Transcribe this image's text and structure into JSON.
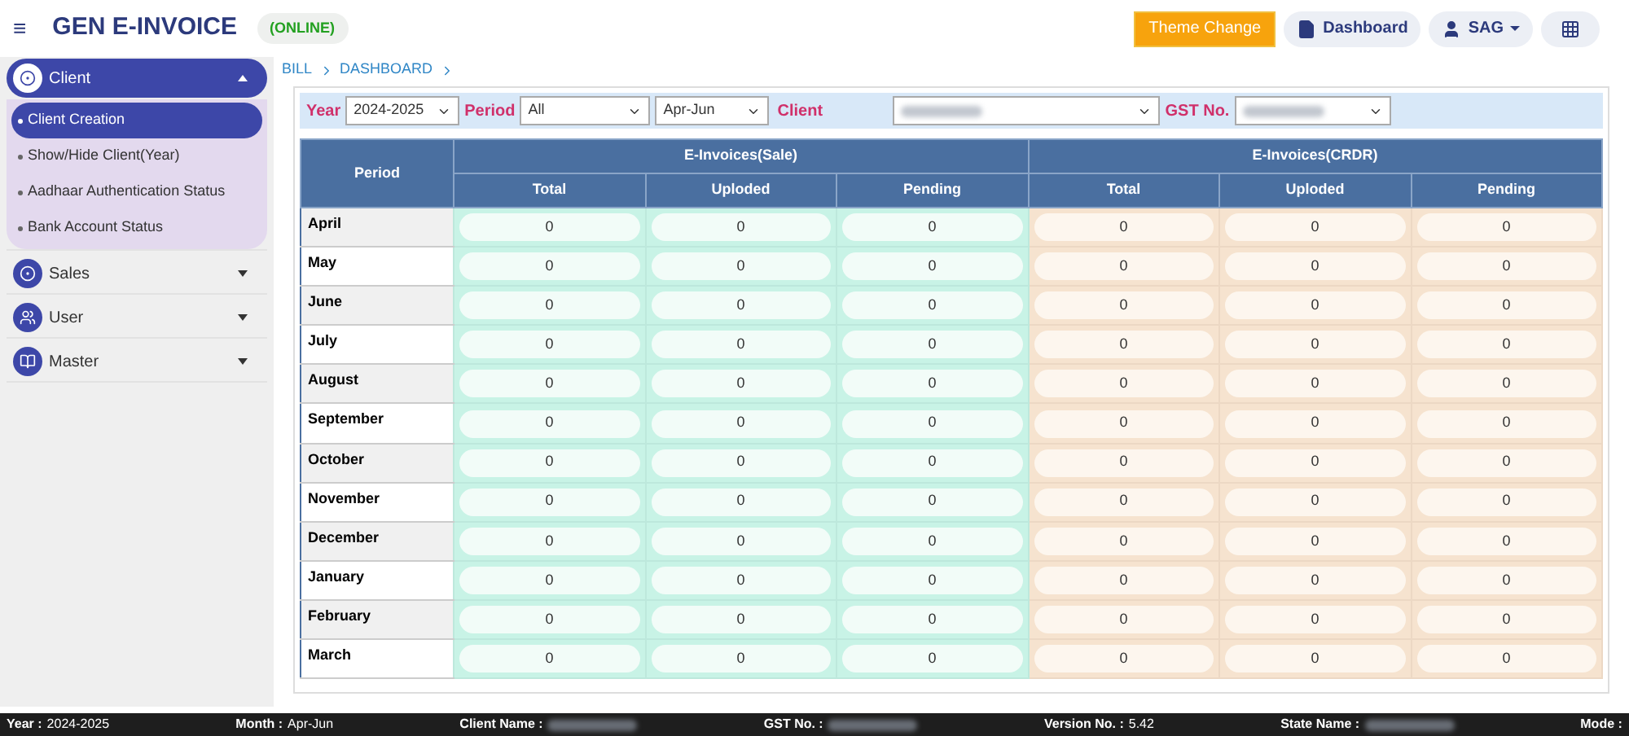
{
  "header": {
    "menu_glyph": "≡",
    "title": "GEN E-INVOICE",
    "status": "(ONLINE)",
    "buttons": [
      {
        "kind": "theme",
        "label": "Theme Change"
      },
      {
        "kind": "page",
        "label": "Dashboard"
      },
      {
        "kind": "user",
        "label": "SAG"
      },
      {
        "kind": "apps"
      }
    ]
  },
  "sidebar": {
    "items": [
      {
        "label": "Client",
        "expanded": true,
        "children": [
          {
            "label": "Client Creation",
            "selected": true
          },
          {
            "label": "Show/Hide Client(Year)",
            "selected": false
          },
          {
            "label": "Aadhaar Authentication Status",
            "selected": false
          },
          {
            "label": "Bank Account Status",
            "selected": false
          }
        ]
      },
      {
        "label": "Sales",
        "expanded": false
      },
      {
        "label": "User",
        "expanded": false
      },
      {
        "label": "Master",
        "expanded": false
      }
    ]
  },
  "breadcrumb": [
    "BILL",
    "DASHBOARD"
  ],
  "filters": [
    {
      "label": "Year",
      "kind": "select",
      "value": "2024-2025"
    },
    {
      "label": "Period",
      "kind": "select",
      "value": "All"
    },
    {
      "kind": "select",
      "value": "Apr-Jun"
    },
    {
      "label": "Client",
      "kind": "redacted"
    },
    {
      "label": "GST No.",
      "kind": "redacted"
    }
  ],
  "table": {
    "period_header": "Period",
    "groups": [
      {
        "title": "E-Invoices(Sale)",
        "kind": "sale",
        "columns": [
          "Total",
          "Uploded",
          "Pending"
        ]
      },
      {
        "title": "E-Invoices(CRDR)",
        "kind": "crdr",
        "columns": [
          "Total",
          "Uploded",
          "Pending"
        ]
      }
    ],
    "rows": [
      {
        "period": "April",
        "values": [
          "0",
          "0",
          "0",
          "0",
          "0",
          "0"
        ]
      },
      {
        "period": "May",
        "values": [
          "0",
          "0",
          "0",
          "0",
          "0",
          "0"
        ]
      },
      {
        "period": "June",
        "values": [
          "0",
          "0",
          "0",
          "0",
          "0",
          "0"
        ]
      },
      {
        "period": "July",
        "values": [
          "0",
          "0",
          "0",
          "0",
          "0",
          "0"
        ]
      },
      {
        "period": "August",
        "values": [
          "0",
          "0",
          "0",
          "0",
          "0",
          "0"
        ]
      },
      {
        "period": "September",
        "values": [
          "0",
          "0",
          "0",
          "0",
          "0",
          "0"
        ]
      },
      {
        "period": "October",
        "values": [
          "0",
          "0",
          "0",
          "0",
          "0",
          "0"
        ]
      },
      {
        "period": "November",
        "values": [
          "0",
          "0",
          "0",
          "0",
          "0",
          "0"
        ]
      },
      {
        "period": "December",
        "values": [
          "0",
          "0",
          "0",
          "0",
          "0",
          "0"
        ]
      },
      {
        "period": "January",
        "values": [
          "0",
          "0",
          "0",
          "0",
          "0",
          "0"
        ]
      },
      {
        "period": "February",
        "values": [
          "0",
          "0",
          "0",
          "0",
          "0",
          "0"
        ]
      },
      {
        "period": "March",
        "values": [
          "0",
          "0",
          "0",
          "0",
          "0",
          "0"
        ]
      }
    ]
  },
  "status_bar": [
    {
      "label": "Year :",
      "kind": "text",
      "value": "2024-2025"
    },
    {
      "label": "Month :",
      "kind": "text",
      "value": "Apr-Jun"
    },
    {
      "label": "Client Name :",
      "kind": "redacted"
    },
    {
      "label": "GST No. :",
      "kind": "redacted"
    },
    {
      "label": "Version No. :",
      "kind": "text",
      "value": "5.42"
    },
    {
      "label": "State Name :",
      "kind": "redacted"
    },
    {
      "label": "Mode :",
      "kind": "empty"
    }
  ]
}
